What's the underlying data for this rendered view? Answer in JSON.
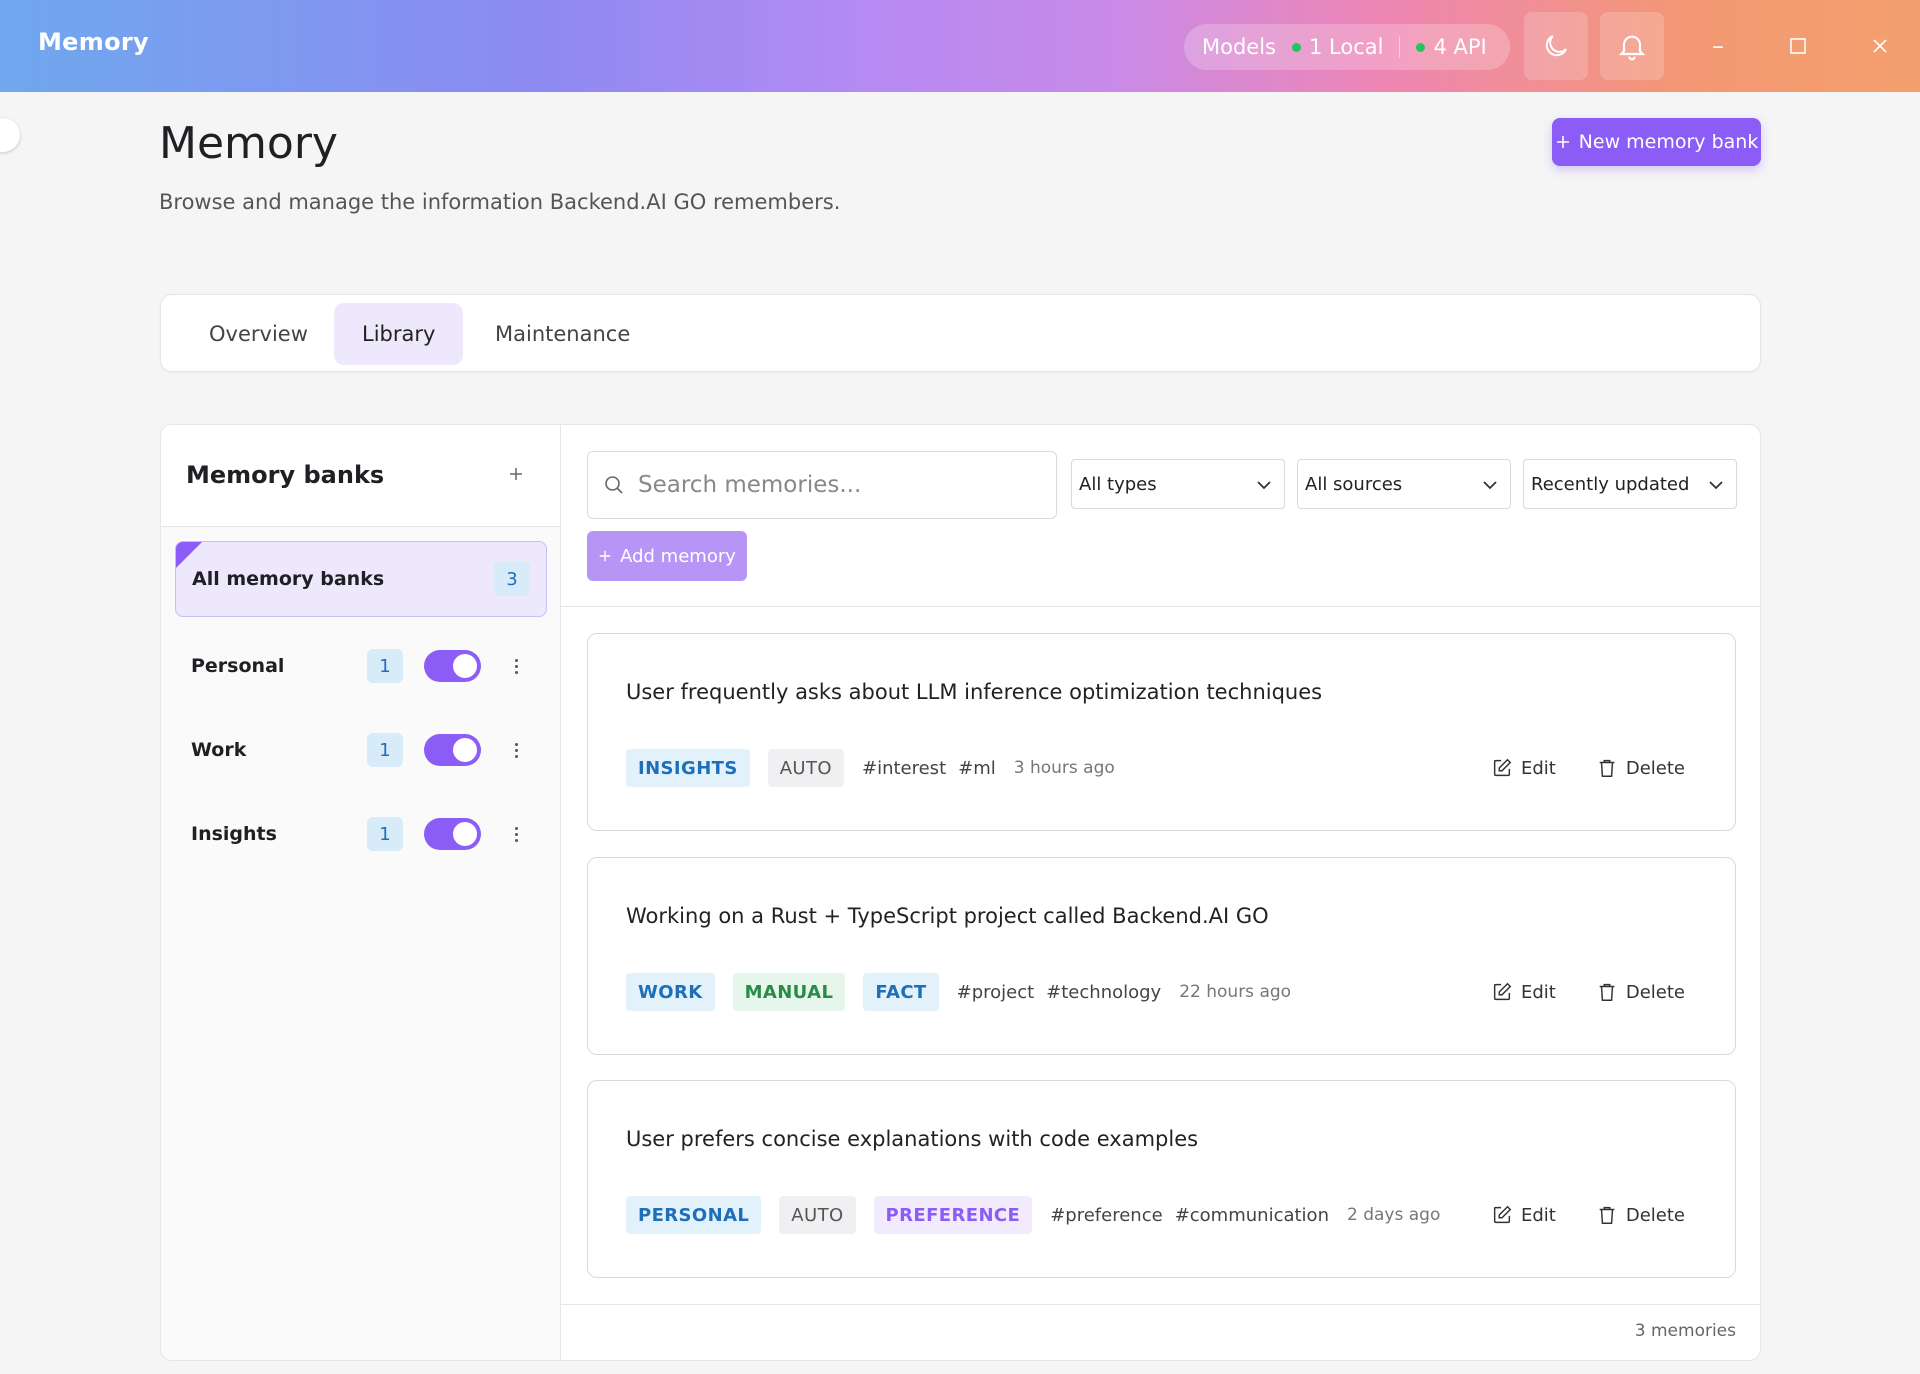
{
  "window": {
    "title": "Memory",
    "models_label": "Models",
    "local_label": "1 Local",
    "api_label": "4 API",
    "minimize": "–",
    "maximize": "☐",
    "close": "✕"
  },
  "header": {
    "title": "Memory",
    "subtitle": "Browse and manage the information Backend.AI GO remembers.",
    "new_bank_label": "New memory bank"
  },
  "tabs": [
    {
      "label": "Overview",
      "active": false
    },
    {
      "label": "Library",
      "active": true
    },
    {
      "label": "Maintenance",
      "active": false
    }
  ],
  "sidebar": {
    "title": "Memory banks",
    "all": {
      "label": "All memory banks",
      "count": "3"
    },
    "banks": [
      {
        "label": "Personal",
        "count": "1",
        "enabled": true
      },
      {
        "label": "Work",
        "count": "1",
        "enabled": true
      },
      {
        "label": "Insights",
        "count": "1",
        "enabled": true
      }
    ]
  },
  "toolbar": {
    "search_placeholder": "Search memories...",
    "type_filter": "All types",
    "source_filter": "All sources",
    "sort": "Recently updated",
    "add_memory_label": "Add memory"
  },
  "memories": [
    {
      "text": "User frequently asks about LLM inference optimization techniques",
      "chips": [
        {
          "label": "INSIGHTS",
          "style": "blue"
        },
        {
          "label": "AUTO",
          "style": "gray"
        }
      ],
      "tags": [
        "#interest",
        "#ml"
      ],
      "time": "3 hours ago"
    },
    {
      "text": "Working on a Rust + TypeScript project called Backend.AI GO",
      "chips": [
        {
          "label": "WORK",
          "style": "blue"
        },
        {
          "label": "MANUAL",
          "style": "green"
        },
        {
          "label": "FACT",
          "style": "blue"
        }
      ],
      "tags": [
        "#project",
        "#technology"
      ],
      "time": "22 hours ago"
    },
    {
      "text": "User prefers concise explanations with code examples",
      "chips": [
        {
          "label": "PERSONAL",
          "style": "blue"
        },
        {
          "label": "AUTO",
          "style": "gray"
        },
        {
          "label": "PREFERENCE",
          "style": "purple"
        }
      ],
      "tags": [
        "#preference",
        "#communication"
      ],
      "time": "2 days ago"
    }
  ],
  "actions": {
    "edit": "Edit",
    "delete": "Delete"
  },
  "footer": {
    "count": "3 memories"
  },
  "colors": {
    "accent": "#8b5cf6",
    "status_dot": "#22c55e",
    "badge_bg": "#d8ebf8",
    "badge_text": "#1d6fb8"
  }
}
